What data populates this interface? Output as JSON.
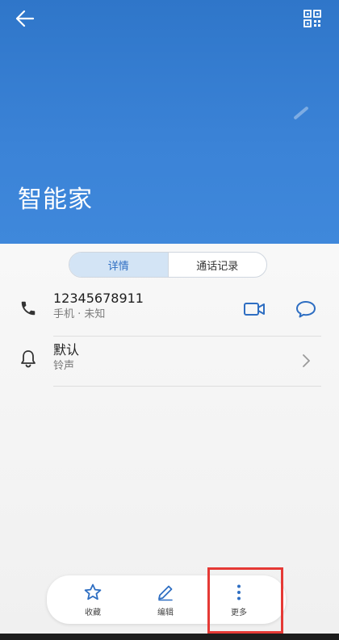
{
  "header": {
    "contact_name": "智能家",
    "back_icon": "back-arrow-icon",
    "qr_icon": "qr-code-icon"
  },
  "tabs": [
    {
      "label": "详情",
      "active": true
    },
    {
      "label": "通话记录",
      "active": false
    }
  ],
  "phone_row": {
    "number": "12345678911",
    "subtitle": "手机 · 未知",
    "icon": "phone-icon",
    "actions": [
      "video-call-icon",
      "message-icon"
    ]
  },
  "ringtone_row": {
    "title": "默认",
    "subtitle": "铃声",
    "icon": "bell-icon",
    "trailing": "chevron-right-icon"
  },
  "bottom_bar": {
    "items": [
      {
        "label": "收藏",
        "icon": "star-icon"
      },
      {
        "label": "编辑",
        "icon": "pen-icon"
      },
      {
        "label": "更多",
        "icon": "more-vertical-icon"
      }
    ]
  },
  "colors": {
    "header_blue": "#3b83d7",
    "accent": "#2e6ec2",
    "highlight_red": "#e53935"
  }
}
